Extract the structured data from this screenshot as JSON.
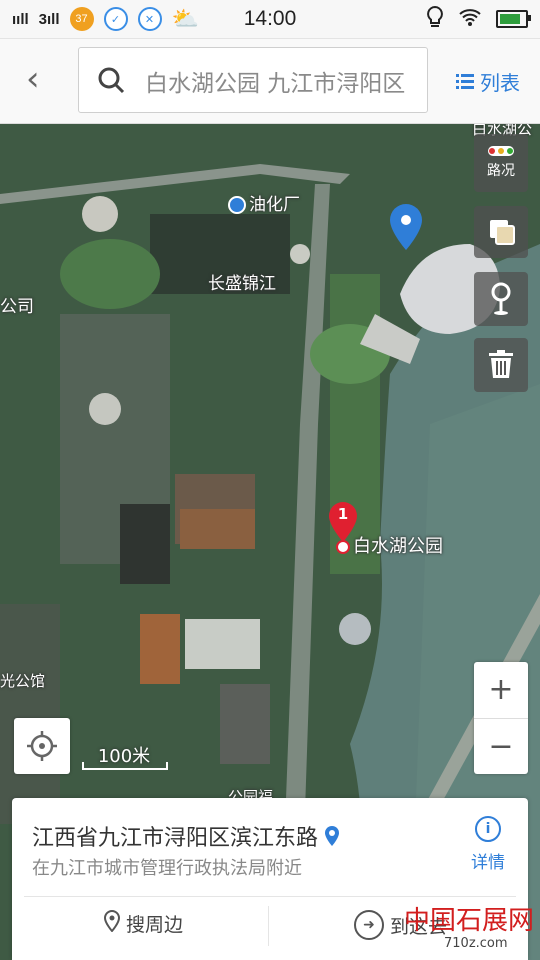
{
  "status_bar": {
    "signal1": "ııll",
    "signal2": "3ıll",
    "notif_badge": "37",
    "time": "14:00"
  },
  "search": {
    "back_label": "‹",
    "query": "白水湖公园 九江市浔阳区",
    "list_label": "列表"
  },
  "map": {
    "labels": {
      "station": "油化厂",
      "complex": "长盛锦江",
      "company": "公司",
      "park": "白水湖公园",
      "top_right": "白水湖公",
      "bottom_left": "光公馆",
      "bottom_mid": "公园福"
    },
    "marker_number": "1",
    "traffic_label": "路况",
    "zoom_in": "+",
    "zoom_out": "−",
    "scale_label": "100米"
  },
  "info_card": {
    "address": "江西省九江市浔阳区滨江东路",
    "nearby": "在九江市城市管理行政执法局附近",
    "detail_label": "详情",
    "search_nearby": "搜周边",
    "go_there": "到这去"
  },
  "watermark": {
    "site_name": "中国石展网",
    "site_url": "710z.com"
  },
  "colors": {
    "accent": "#2f7ed8",
    "marker_red": "#e02030",
    "water": "#5f7f7a"
  }
}
